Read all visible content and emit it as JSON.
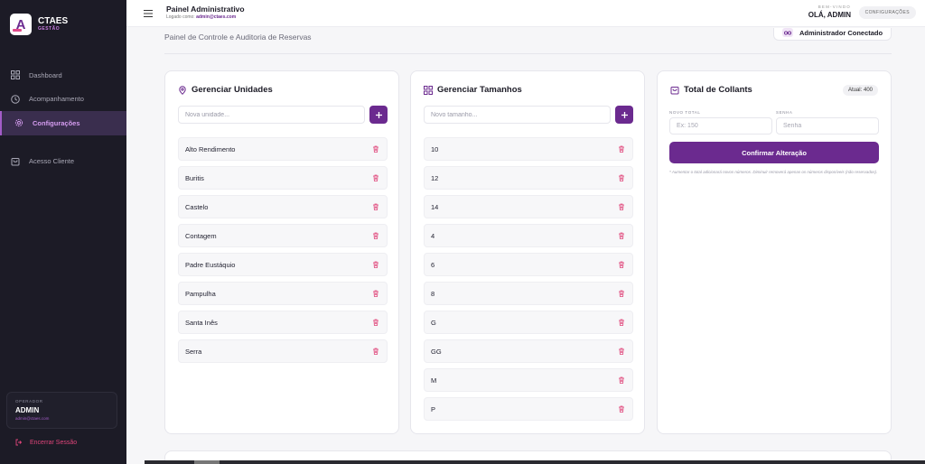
{
  "brand": {
    "name": "CTAES",
    "sub": "GESTÃO"
  },
  "sidebar": {
    "items": [
      {
        "label": "Dashboard"
      },
      {
        "label": "Acompanhamento"
      },
      {
        "label": "Configurações"
      },
      {
        "label": "Acesso Cliente"
      }
    ],
    "user": {
      "role": "OPERADOR",
      "name": "ADMIN",
      "email": "admin@ctaes.com"
    },
    "logout_label": "Encerrar Sessão"
  },
  "header": {
    "title": "Painel Administrativo",
    "logged_prefix": "Logado como:",
    "logged_email": "admin@ctaes.com",
    "welcome_small": "BEM-VINDO",
    "welcome_name": "OLÁ, ADMIN",
    "config_pill": "CONFIGURAÇÕES"
  },
  "page": {
    "subtitle": "Painel de Controle e Auditoria de Reservas",
    "admin_badge": "Administrador Conectado"
  },
  "unidades": {
    "title": "Gerenciar Unidades",
    "placeholder": "Nova unidade...",
    "items": [
      "Alto Rendimento",
      "Buritis",
      "Castelo",
      "Contagem",
      "Padre Eustáquio",
      "Pampulha",
      "Santa Inês",
      "Serra"
    ]
  },
  "tamanhos": {
    "title": "Gerenciar Tamanhos",
    "placeholder": "Novo tamanho...",
    "items": [
      "10",
      "12",
      "14",
      "4",
      "6",
      "8",
      "G",
      "GG",
      "M",
      "P"
    ]
  },
  "collants": {
    "title": "Total de Collants",
    "atual": "Atual: 400",
    "novo_total_label": "NOVO TOTAL",
    "novo_total_placeholder": "Ex: 150",
    "senha_label": "SENHA",
    "senha_placeholder": "Senha",
    "confirm_label": "Confirmar Alteração",
    "note": "* Aumentar o total adicionará novos números. Diminuir removerá apenas os números disponíveis (não reservados)."
  },
  "colors": {
    "accent": "#6b2a8f",
    "sidebar_bg": "#1c1b26",
    "danger": "#e0457a"
  }
}
